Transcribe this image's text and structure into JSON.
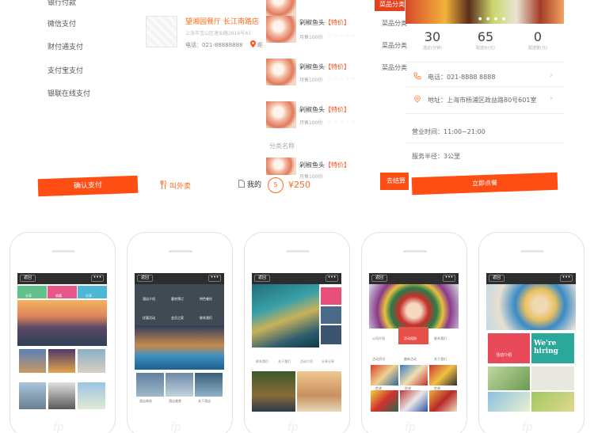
{
  "payment": {
    "items": [
      "微信支付",
      "财付通支付",
      "支付宝支付",
      "银联在线支付"
    ],
    "confirm_label": "确认支付"
  },
  "shop": {
    "name": "望湘园餐厅 长江南路店",
    "address": "上海市宝山区逸仙路2816号A1",
    "phone": "电话：021-88888888",
    "pin_text": "距",
    "order_out_label": "叫外卖",
    "mine_label": "我的"
  },
  "dishes": {
    "items": [
      {
        "name": "剁椒鱼头",
        "tag": "【特价】",
        "sub": "月售100份"
      },
      {
        "name": "剁椒鱼头",
        "tag": "【特价】",
        "sub": "月售100份"
      },
      {
        "name": "剁椒鱼头",
        "tag": "【特价】",
        "sub": "月售100份"
      },
      {
        "name": "剁椒鱼头",
        "tag": "【特价】",
        "sub": "月售100份"
      },
      {
        "name": "剁椒鱼头",
        "tag": "【特价】",
        "sub": "月售100份"
      }
    ],
    "stars": "☆☆☆☆☆",
    "category_label": "分类名称",
    "cart_count": "5",
    "cart_price": "¥250"
  },
  "categories": {
    "active": "菜品分类",
    "items": [
      "菜品分类",
      "菜品分类",
      "菜品分类"
    ],
    "settle_label": "去结算"
  },
  "store": {
    "stats": [
      {
        "value": "30",
        "label": "送达(分钟)"
      },
      {
        "value": "65",
        "label": "配送价(元)"
      },
      {
        "value": "0",
        "label": "配送费(元)"
      }
    ],
    "phone": "电话：021-8888 8888",
    "address": "地址：上海市杨浦区政益路80号601室",
    "hours": "营业时间：11:00~21:00",
    "radius": "服务半径：3公里",
    "order_now_label": "立即点餐",
    "dots": "● ● ● ●"
  },
  "phones": {
    "back_label": "返回",
    "more_label": "•••",
    "logo_text": "fp",
    "screen1_tabs": [
      "分享",
      "收藏",
      "分享"
    ],
    "screen2_icons": [
      "酒店介绍",
      "客房预订",
      "特色餐饮",
      "优惠活动",
      "会员之家",
      "联系我们"
    ],
    "screen2_tiles": [
      "酒店商务",
      "酒店美食",
      "关于酒店"
    ],
    "screen3_tiles": [
      "联系我们",
      "关于我们",
      "活动介绍",
      "分享分享"
    ],
    "screen4_icons": [
      "公司介绍",
      "活动相册",
      "联系我们",
      "活动资讯",
      "最新活动",
      "关于我们"
    ],
    "screen4_tiles": [
      "脸谱",
      "脸谱",
      "脸谱",
      "脸谱",
      "脸谱",
      "脸谱"
    ],
    "screen5_tiles": [
      "活动介绍",
      "We're hiring"
    ]
  },
  "colors": {
    "accent": "#ff4e14",
    "orange_text": "#ff6a1a"
  }
}
